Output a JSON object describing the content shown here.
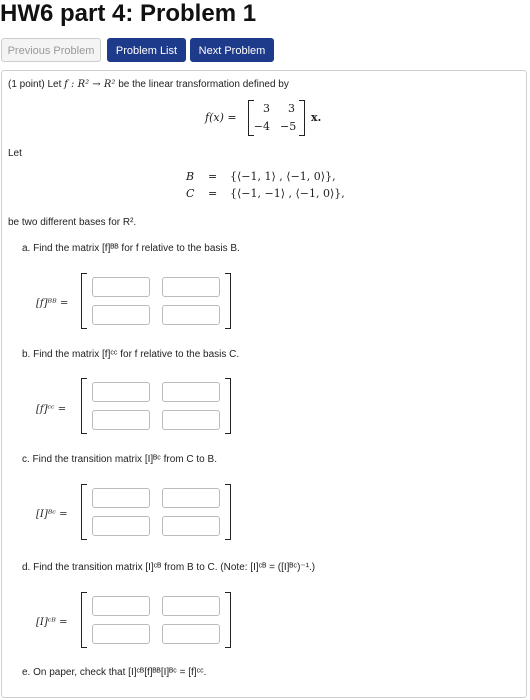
{
  "title": "HW6 part 4: Problem 1",
  "nav": {
    "prev": "Previous Problem",
    "list": "Problem List",
    "next": "Next Problem"
  },
  "problem": {
    "intro_points": "(1 point) Let",
    "intro_func": "f : R² → R²",
    "intro_rest": "be the linear transformation defined by",
    "fx_lhs": "f(x) =",
    "matrix": [
      [
        "3",
        "3"
      ],
      [
        "−4",
        "−5"
      ]
    ],
    "fx_rhs": "x.",
    "let": "Let",
    "basis_B_sym": "B",
    "basis_B_eq": "=",
    "basis_B_val": "{⟨−1, 1⟩ , ⟨−1, 0⟩},",
    "basis_C_sym": "C",
    "basis_C_eq": "=",
    "basis_C_val": "{⟨−1, −1⟩ , ⟨−1, 0⟩},",
    "bases_text": "be two different bases for R².",
    "parts": [
      {
        "prompt": "a. Find the matrix [f]ᴮᴮ for f relative to the basis B.",
        "label": "[f]ᴮᴮ ="
      },
      {
        "prompt": "b. Find the matrix [f]ᶜᶜ for f relative to the basis C.",
        "label": "[f]ᶜᶜ ="
      },
      {
        "prompt": "c. Find the transition matrix [I]ᴮᶜ from C to B.",
        "label": "[I]ᴮᶜ ="
      },
      {
        "prompt": "d. Find the transition matrix [I]ᶜᴮ from B to C. (Note: [I]ᶜᴮ = ([I]ᴮᶜ)⁻¹.)",
        "label": "[I]ᶜᴮ ="
      }
    ],
    "part_e": "e. On paper, check that [I]ᶜᴮ[f]ᴮᴮ[I]ᴮᶜ = [f]ᶜᶜ."
  }
}
